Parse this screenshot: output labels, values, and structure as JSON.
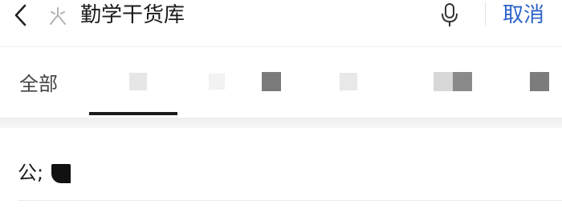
{
  "header": {
    "search_query": "勤学干货库",
    "cancel_label": "取消",
    "icons": {
      "back": "chevron-left-icon",
      "search": "sparkle-search-icon",
      "mic": "microphone-icon"
    },
    "accent_color": "#2b62c8"
  },
  "tabs": [
    {
      "label": "全部",
      "selected": true
    },
    {
      "label": "",
      "pixelated": true,
      "color": "#e6e6e6"
    },
    {
      "label": "",
      "pixelated": true,
      "color": "#f2f2f2"
    },
    {
      "label": "",
      "pixelated": true,
      "color": "#7a7a7a"
    },
    {
      "label": "",
      "pixelated": true,
      "color": "#e8e8e8"
    },
    {
      "label": "",
      "pixelated": true,
      "color": "#d8d8d8"
    },
    {
      "label": "",
      "pixelated": true,
      "color": "#7c7c7c"
    }
  ],
  "results": [
    {
      "title": "公;",
      "redacted": true
    }
  ]
}
